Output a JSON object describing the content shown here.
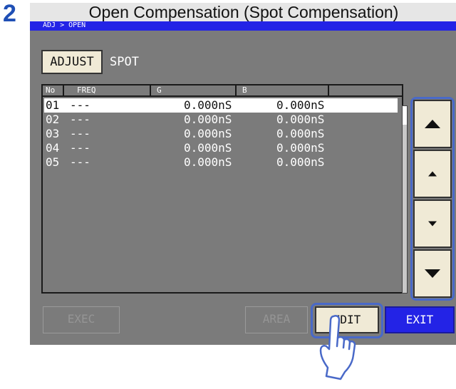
{
  "step_number": "2",
  "heading": "Open Compensation (Spot Compensation)",
  "breadcrumb": "ADJ > OPEN",
  "adjust_button": "ADJUST",
  "mode_label": "SPOT",
  "table": {
    "headers": [
      "No",
      "FREQ",
      "G",
      "B"
    ],
    "rows": [
      {
        "no": "01",
        "freq": "---",
        "g": "0.000nS",
        "b": "0.000nS",
        "selected": true
      },
      {
        "no": "02",
        "freq": "---",
        "g": "0.000nS",
        "b": "0.000nS"
      },
      {
        "no": "03",
        "freq": "---",
        "g": "0.000nS",
        "b": "0.000nS"
      },
      {
        "no": "04",
        "freq": "---",
        "g": "0.000nS",
        "b": "0.000nS"
      },
      {
        "no": "05",
        "freq": "---",
        "g": "0.000nS",
        "b": "0.000nS"
      }
    ]
  },
  "scroll_buttons": [
    {
      "name": "page-up-icon"
    },
    {
      "name": "line-up-icon"
    },
    {
      "name": "line-down-icon"
    },
    {
      "name": "page-down-icon"
    }
  ],
  "bottom_buttons": {
    "exec": "EXEC",
    "area": "AREA",
    "edit": "EDIT",
    "exit": "EXIT"
  },
  "colors": {
    "accent_blue": "#2323e6",
    "highlight_outline": "#4969c8",
    "screen_background": "#7b7b7b",
    "button_face": "#f0ead6"
  }
}
